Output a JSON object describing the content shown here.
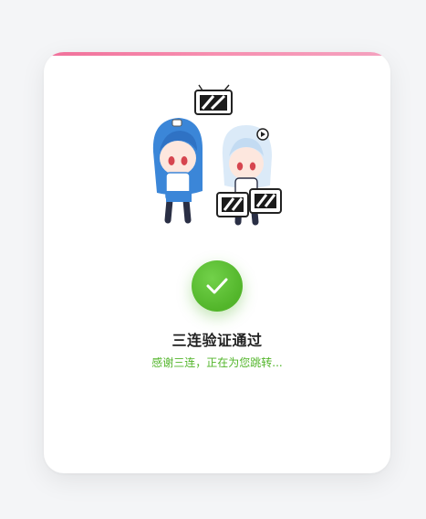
{
  "verify": {
    "title": "三连验证通过",
    "subtitle": "感谢三连，正在为您跳转..."
  },
  "icons": {
    "success": "check-icon",
    "mascot": "mascot-illustration"
  },
  "colors": {
    "accent_gradient": [
      "#f0709a",
      "#f4a2bf"
    ],
    "success_green": "#52b52a",
    "background": "#f4f5f7",
    "card": "#ffffff"
  }
}
